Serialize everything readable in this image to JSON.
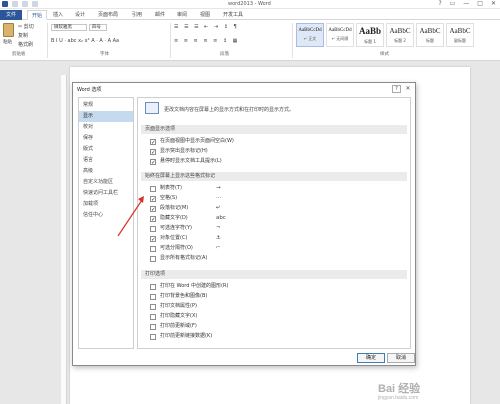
{
  "window": {
    "title": "word2013 - Word",
    "controls": [
      "?",
      "▭",
      "—",
      "□",
      "✕"
    ]
  },
  "ribbon_tabs": [
    {
      "label": "文件",
      "active": false,
      "file": true
    },
    {
      "label": "开始",
      "active": true
    },
    {
      "label": "插入",
      "active": false
    },
    {
      "label": "设计",
      "active": false
    },
    {
      "label": "页面布局",
      "active": false
    },
    {
      "label": "引用",
      "active": false
    },
    {
      "label": "邮件",
      "active": false
    },
    {
      "label": "审阅",
      "active": false
    },
    {
      "label": "视图",
      "active": false
    },
    {
      "label": "开发工具",
      "active": false
    }
  ],
  "ribbon": {
    "clipboard": {
      "paste": "粘贴",
      "cut": "✂ 剪切",
      "copy": "复制",
      "format_painter": "格式刷",
      "group": "剪贴板"
    },
    "font": {
      "name": "微软雅黑",
      "size": "四号",
      "group": "字体",
      "buttons": "B  I  U  · abc  x₂  x²  A  ·  A  ·  A  Aa"
    },
    "paragraph": {
      "group": "段落"
    },
    "styles": {
      "group": "样式",
      "items": [
        {
          "sample": "AaBbCcDd",
          "name": "↵ 正文",
          "size": "small"
        },
        {
          "sample": "AaBbCcDd",
          "name": "↵ 无间隔",
          "size": "small"
        },
        {
          "sample": "AaBb",
          "name": "标题 1",
          "size": "big"
        },
        {
          "sample": "AaBbC",
          "name": "标题 2",
          "size": "mid"
        },
        {
          "sample": "AaBbC",
          "name": "标题",
          "size": "mid"
        },
        {
          "sample": "AaBbC",
          "name": "副标题",
          "size": "mid"
        }
      ]
    }
  },
  "dialog": {
    "title": "Word 选项",
    "help": "?",
    "close": "✕",
    "nav": [
      {
        "label": "常规",
        "active": false
      },
      {
        "label": "显示",
        "active": true
      },
      {
        "label": "校对",
        "active": false
      },
      {
        "label": "保存",
        "active": false
      },
      {
        "label": "版式",
        "active": false
      },
      {
        "label": "语言",
        "active": false
      },
      {
        "label": "高级",
        "active": false
      },
      {
        "label": "自定义功能区",
        "active": false
      },
      {
        "label": "快速访问工具栏",
        "active": false
      },
      {
        "label": "加载项",
        "active": false
      },
      {
        "label": "信任中心",
        "active": false
      }
    ],
    "intro": "更改文档内容在屏幕上的显示方式和在打印时的显示方式。",
    "sections": {
      "page_display": {
        "header": "页面显示选项",
        "items": [
          {
            "label": "在页面视图中显示页面间空白(W)",
            "checked": true
          },
          {
            "label": "显示突出显示标记(H)",
            "checked": true
          },
          {
            "label": "悬停时显示文档工具提示(L)",
            "checked": true
          }
        ]
      },
      "format_marks": {
        "header": "始终在屏幕上显示这些格式标记",
        "items": [
          {
            "label": "制表符(T)",
            "symbol": "→",
            "checked": false
          },
          {
            "label": "空格(S)",
            "symbol": "···",
            "checked": true
          },
          {
            "label": "段落标记(M)",
            "symbol": "↵",
            "checked": true
          },
          {
            "label": "隐藏文字(D)",
            "symbol": "abc",
            "checked": true
          },
          {
            "label": "可选连字符(Y)",
            "symbol": "¬",
            "checked": false
          },
          {
            "label": "对象位置(C)",
            "symbol": "⚓",
            "checked": true
          },
          {
            "label": "可选分隔符(O)",
            "symbol": "⌐",
            "checked": false
          },
          {
            "label": "显示所有格式标记(A)",
            "symbol": "",
            "checked": false
          }
        ]
      },
      "print": {
        "header": "打印选项",
        "items": [
          {
            "label": "打印在 Word 中创建的图形(R)",
            "checked": false
          },
          {
            "label": "打印背景色和图像(B)",
            "checked": false
          },
          {
            "label": "打印文档属性(P)",
            "checked": false
          },
          {
            "label": "打印隐藏文字(X)",
            "checked": false
          },
          {
            "label": "打印前更新域(F)",
            "checked": false
          },
          {
            "label": "打印前更新链接数据(K)",
            "checked": false
          }
        ]
      }
    },
    "ok_label": "确定",
    "cancel_label": "取消"
  },
  "watermark": {
    "main": "Bai 经验",
    "sub": "jingyan.baidu.com"
  },
  "colors": {
    "accent": "#2b579a",
    "nav_selected": "#c5d9ef",
    "annotation": "#d9302b"
  }
}
